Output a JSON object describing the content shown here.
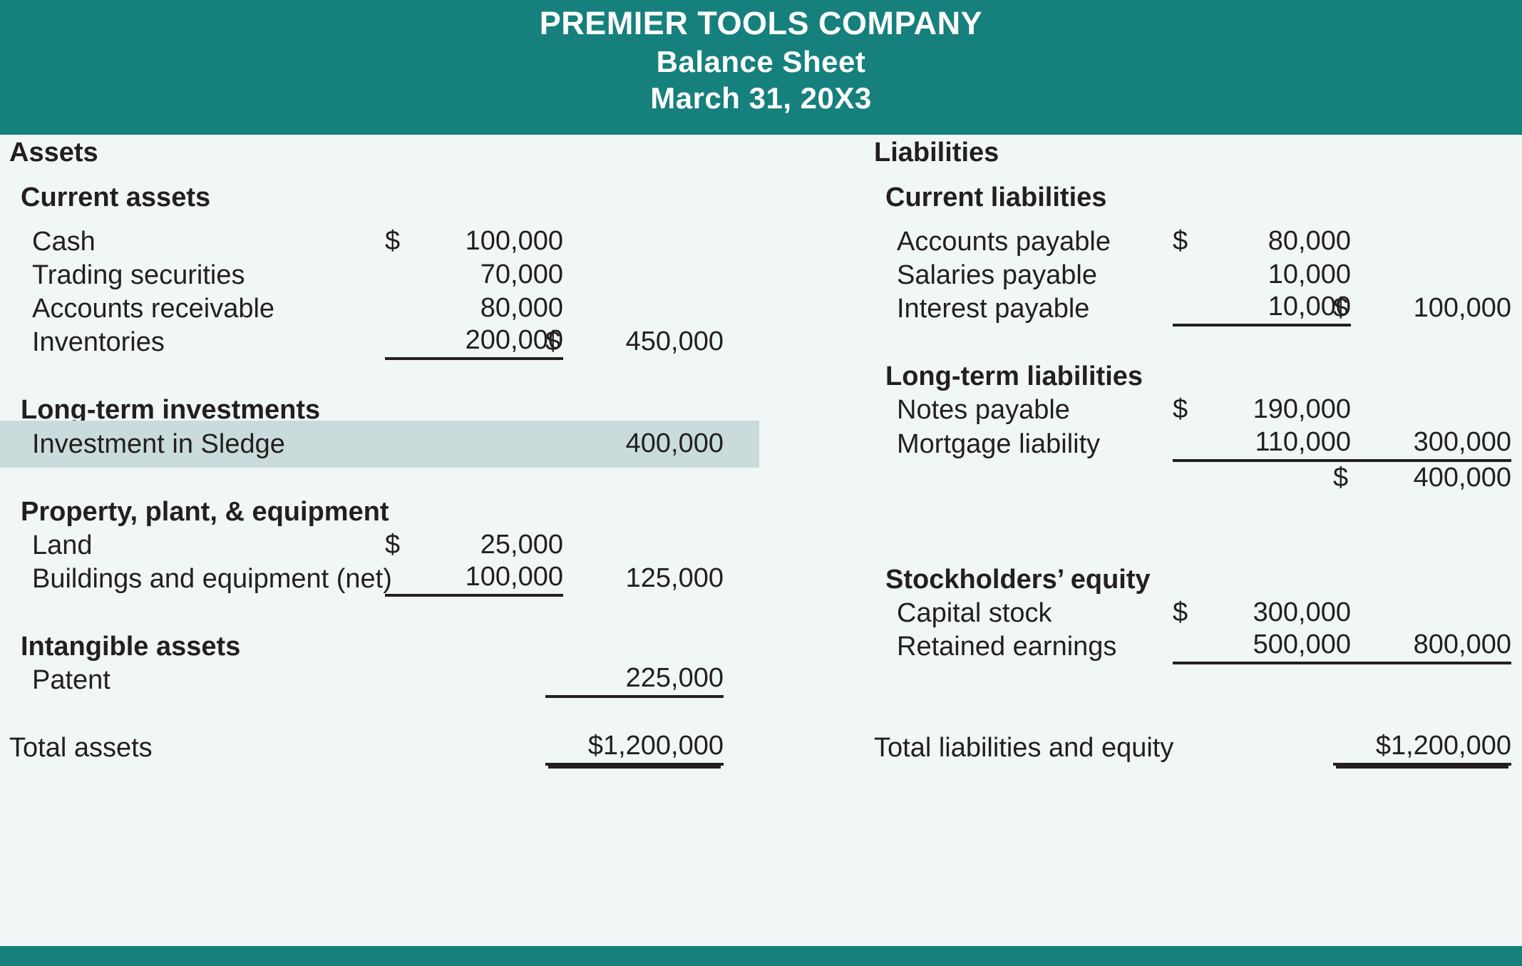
{
  "header": {
    "company": "PREMIER TOOLS COMPANY",
    "statement": "Balance Sheet",
    "date": "March 31, 20X3"
  },
  "colors": {
    "header_bar": "#16807d",
    "page_background": "#f1f6f6",
    "highlight_row": "#c9dcdb",
    "text": "#231f20"
  },
  "left": {
    "heading": "Assets",
    "current_assets": {
      "heading": "Current assets",
      "items": [
        {
          "label": "Cash",
          "c1_cur": "$",
          "c1": "100,000"
        },
        {
          "label": "Trading securities",
          "c1_cur": "",
          "c1": "70,000"
        },
        {
          "label": "Accounts receivable",
          "c1_cur": "",
          "c1": "80,000"
        },
        {
          "label": "Inventories",
          "c1_cur": "",
          "c1": "200,000",
          "c2_cur": "$",
          "c2": "450,000"
        }
      ]
    },
    "long_term_investments": {
      "heading": "Long-term investments",
      "items": [
        {
          "label": "Investment in Sledge",
          "c2_cur": "",
          "c2": "400,000"
        }
      ]
    },
    "ppe": {
      "heading": "Property, plant, & equipment",
      "items": [
        {
          "label": "Land",
          "c1_cur": "$",
          "c1": "25,000"
        },
        {
          "label": "Buildings and equipment (net)",
          "c1_cur": "",
          "c1": "100,000",
          "c2_cur": "",
          "c2": "125,000"
        }
      ]
    },
    "intangible_assets": {
      "heading": "Intangible assets",
      "items": [
        {
          "label": "Patent",
          "c2_cur": "",
          "c2": "225,000"
        }
      ]
    },
    "total": {
      "label": "Total assets",
      "cur": "",
      "amount": "$1,200,000"
    }
  },
  "right": {
    "heading": "Liabilities",
    "current_liabilities": {
      "heading": "Current liabilities",
      "items": [
        {
          "label": "Accounts payable",
          "c1_cur": "$",
          "c1": "80,000"
        },
        {
          "label": "Salaries payable",
          "c1_cur": "",
          "c1": "10,000"
        },
        {
          "label": "Interest payable",
          "c1_cur": "",
          "c1": "10,000",
          "c2_cur": "$",
          "c2": "100,000"
        }
      ]
    },
    "long_term_liabilities": {
      "heading": "Long-term liabilities",
      "items": [
        {
          "label": "Notes payable",
          "c1_cur": "$",
          "c1": "190,000"
        },
        {
          "label": "Mortgage liability",
          "c1_cur": "",
          "c1": "110,000",
          "c2_cur": "",
          "c2": "300,000"
        }
      ],
      "subtotal": {
        "cur": "$",
        "amount": "400,000"
      }
    },
    "stockholders_equity": {
      "heading": "Stockholders’ equity",
      "items": [
        {
          "label": "Capital stock",
          "c1_cur": "$",
          "c1": "300,000"
        },
        {
          "label": "Retained earnings",
          "c1_cur": "",
          "c1": "500,000",
          "c2_cur": "",
          "c2": "800,000"
        }
      ]
    },
    "total": {
      "label": "Total liabilities and equity",
      "cur": "",
      "amount": "$1,200,000"
    }
  }
}
